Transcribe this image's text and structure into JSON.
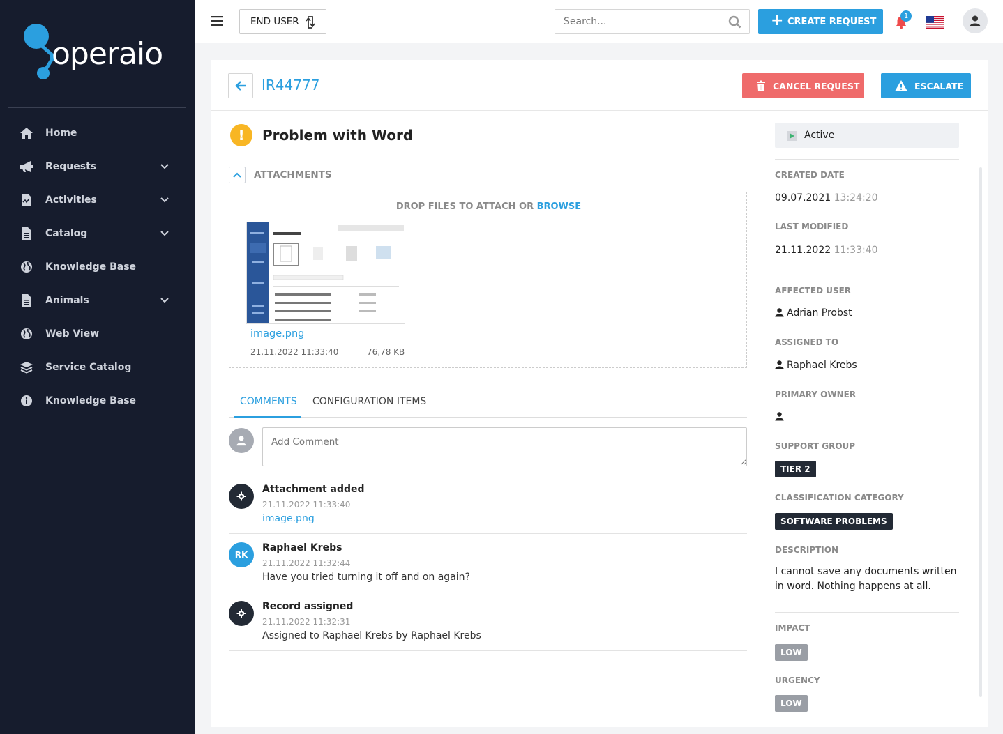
{
  "brand": {
    "name": "operaio"
  },
  "sidebar": {
    "items": [
      {
        "label": "Home",
        "icon": "home-icon",
        "expandable": false
      },
      {
        "label": "Requests",
        "icon": "megaphone-icon",
        "expandable": true
      },
      {
        "label": "Activities",
        "icon": "file-chart-icon",
        "expandable": true
      },
      {
        "label": "Catalog",
        "icon": "document-icon",
        "expandable": true
      },
      {
        "label": "Knowledge Base",
        "icon": "globe-icon",
        "expandable": false
      },
      {
        "label": "Animals",
        "icon": "document-icon",
        "expandable": true
      },
      {
        "label": "Web View",
        "icon": "globe-icon",
        "expandable": false
      },
      {
        "label": "Service Catalog",
        "icon": "layers-icon",
        "expandable": false
      },
      {
        "label": "Knowledge Base",
        "icon": "info-icon",
        "expandable": false
      }
    ]
  },
  "topbar": {
    "role_label": "END USER",
    "search_placeholder": "Search...",
    "create_label": "CREATE REQUEST",
    "notification_count": "1"
  },
  "request": {
    "id": "IR44777",
    "cancel_label": "CANCEL REQUEST",
    "escalate_label": "ESCALATE",
    "warning_glyph": "!",
    "title": "Problem with Word",
    "attachments_label": "ATTACHMENTS",
    "drop_text": "DROP FILES TO ATTACH OR",
    "browse_label": "BROWSE",
    "attachment": {
      "name": "image.png",
      "date": "21.11.2022 11:33:40",
      "size": "76,78 KB"
    }
  },
  "tabs": [
    {
      "label": "COMMENTS",
      "active": true
    },
    {
      "label": "CONFIGURATION ITEMS",
      "active": false
    }
  ],
  "comment_placeholder": "Add Comment",
  "activity": [
    {
      "title": "Attachment added",
      "time": "21.11.2022 11:33:40",
      "body": "image.png",
      "icon": "gear-icon",
      "initials": ""
    },
    {
      "title": "Raphael Krebs",
      "time": "21.11.2022 11:32:44",
      "body": "Have you tried turning it off and on again?",
      "icon": "avatar",
      "initials": "RK"
    },
    {
      "title": "Record assigned",
      "time": "21.11.2022 11:32:31",
      "body": "Assigned to Raphael Krebs by Raphael Krebs",
      "icon": "gear-icon",
      "initials": ""
    }
  ],
  "details": {
    "status": "Active",
    "created_label": "CREATED DATE",
    "created_date": "09.07.2021",
    "created_time": "13:24:20",
    "modified_label": "LAST MODIFIED",
    "modified_date": "21.11.2022",
    "modified_time": "11:33:40",
    "affected_label": "AFFECTED USER",
    "affected_user": "Adrian Probst",
    "assigned_label": "ASSIGNED TO",
    "assigned_to": "Raphael Krebs",
    "owner_label": "PRIMARY OWNER",
    "owner": "",
    "group_label": "SUPPORT GROUP",
    "group": "TIER 2",
    "category_label": "CLASSIFICATION CATEGORY",
    "category": "SOFTWARE PROBLEMS",
    "description_label": "DESCRIPTION",
    "description": "I cannot save any documents written in word. Nothing happens at all.",
    "impact_label": "IMPACT",
    "impact": "LOW",
    "urgency_label": "URGENCY",
    "urgency": "LOW"
  },
  "colors": {
    "accent": "#2b9fdf",
    "sidebar": "#161c2d",
    "danger": "#ef6b6b",
    "warning": "#f8b624",
    "dark_pill": "#232a35"
  }
}
